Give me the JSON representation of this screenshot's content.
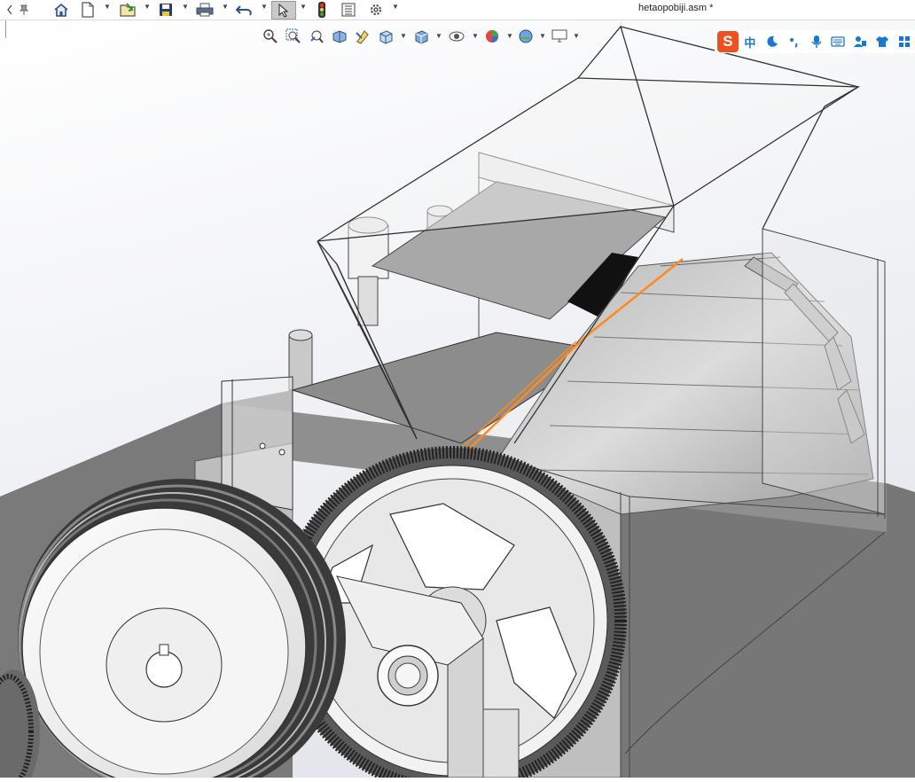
{
  "window": {
    "document_title": "hetaopobiji.asm *"
  },
  "toolbar": {
    "items": [
      {
        "name": "pin-icon"
      },
      {
        "name": "home-icon"
      },
      {
        "name": "new-document-icon"
      },
      {
        "name": "open-document-icon"
      },
      {
        "name": "save-icon"
      },
      {
        "name": "print-icon"
      },
      {
        "name": "undo-icon"
      },
      {
        "name": "select-arrow-icon"
      },
      {
        "name": "rebuild-traffic-light-icon"
      },
      {
        "name": "file-properties-icon"
      },
      {
        "name": "options-gear-icon"
      }
    ]
  },
  "heads_up_toolbar": {
    "items": [
      {
        "name": "zoom-to-fit-icon"
      },
      {
        "name": "zoom-to-area-icon"
      },
      {
        "name": "previous-view-icon"
      },
      {
        "name": "section-view-icon"
      },
      {
        "name": "dynamic-annotation-view-icon"
      },
      {
        "name": "view-orientation-icon"
      },
      {
        "name": "display-style-icon"
      },
      {
        "name": "hide-show-items-icon"
      },
      {
        "name": "edit-appearance-icon"
      },
      {
        "name": "apply-scene-icon"
      },
      {
        "name": "view-settings-icon"
      }
    ]
  },
  "ime_bar": {
    "logo": "S",
    "language": "中",
    "items": [
      {
        "name": "half-width-moon-icon"
      },
      {
        "name": "punctuation-icon"
      },
      {
        "name": "microphone-icon"
      },
      {
        "name": "keyboard-icon"
      },
      {
        "name": "user-settings-icon"
      },
      {
        "name": "skin-shirt-icon"
      },
      {
        "name": "toolbox-grid-icon"
      }
    ]
  },
  "colors": {
    "background_top": "#ffffff",
    "background_bottom": "#e6e9ee",
    "highlight_edge": "#ff8a1e",
    "ime_accent": "#1877d2",
    "ime_logo": "#f0501e"
  }
}
